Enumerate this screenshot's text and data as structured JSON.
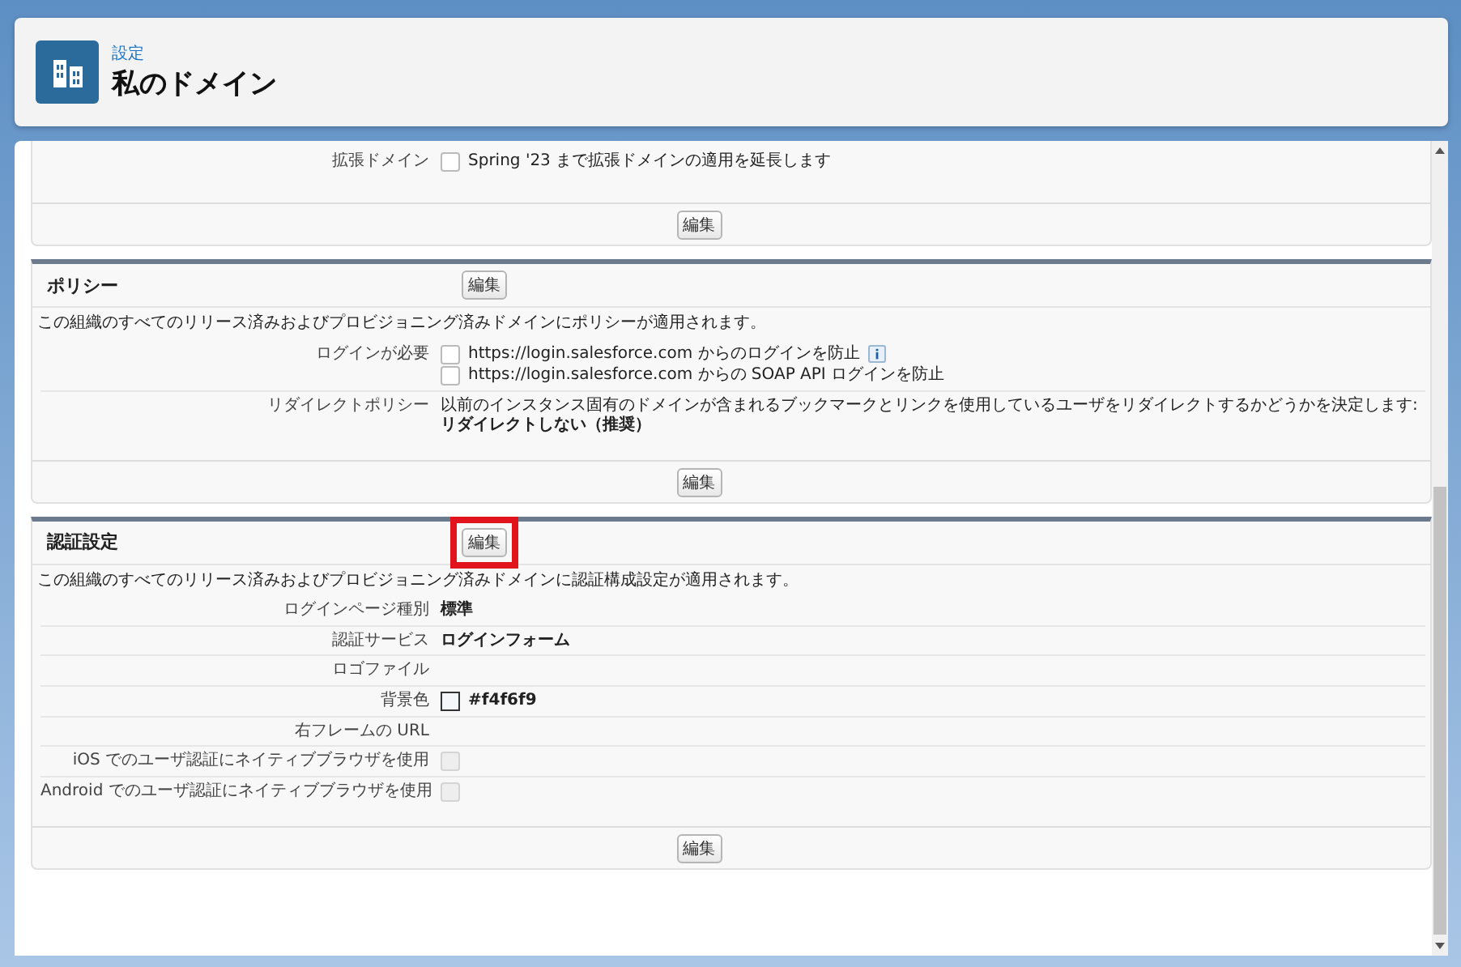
{
  "header": {
    "breadcrumb": "設定",
    "title": "私のドメイン"
  },
  "sections": [
    {
      "rows": [
        {
          "label": "拡張ドメイン",
          "kind": "checkboxes",
          "options": [
            {
              "text": "Spring '23 まで拡張ドメインの適用を延長します",
              "checked": false,
              "disabled": false,
              "info": false
            }
          ]
        }
      ],
      "footer_button": {
        "label": "編集"
      }
    },
    {
      "title": "ポリシー",
      "header_button": {
        "label": "編集"
      },
      "description": "この組織のすべてのリリース済みおよびプロビジョニング済みドメインにポリシーが適用されます。",
      "rows": [
        {
          "label": "ログインが必要",
          "kind": "checkboxes",
          "options": [
            {
              "text": "https://login.salesforce.com からのログインを防止",
              "checked": false,
              "disabled": false,
              "info": true
            },
            {
              "text": "https://login.salesforce.com からの SOAP API ログインを防止",
              "checked": false,
              "disabled": false,
              "info": false
            }
          ]
        },
        {
          "label": "リダイレクトポリシー",
          "kind": "text",
          "lines": [
            {
              "text": "以前のインスタンス固有のドメインが含まれるブックマークとリンクを使用しているユーザをリダイレクトするかどうかを決定します:",
              "bold": false
            },
            {
              "text": "リダイレクトしない（推奨）",
              "bold": true
            }
          ]
        }
      ],
      "footer_button": {
        "label": "編集"
      }
    },
    {
      "title": "認証設定",
      "header_button": {
        "label": "編集",
        "highlighted": true
      },
      "description": "この組織のすべてのリリース済みおよびプロビジョニング済みドメインに認証構成設定が適用されます。",
      "rows": [
        {
          "label": "ログインページ種別",
          "kind": "text",
          "lines": [
            {
              "text": "標準",
              "bold": true
            }
          ]
        },
        {
          "label": "認証サービス",
          "kind": "text",
          "lines": [
            {
              "text": "ログインフォーム",
              "bold": true
            }
          ]
        },
        {
          "label": "ロゴファイル",
          "kind": "text",
          "lines": []
        },
        {
          "label": "背景色",
          "kind": "color",
          "color": "#f4f6f9",
          "value": "#f4f6f9"
        },
        {
          "label": "右フレームの URL",
          "kind": "text",
          "lines": []
        },
        {
          "label": "iOS でのユーザ認証にネイティブブラウザを使用",
          "kind": "checkboxes",
          "options": [
            {
              "checked": false,
              "disabled": true,
              "info": false
            }
          ]
        },
        {
          "label": "Android でのユーザ認証にネイティブブラウザを使用",
          "kind": "checkboxes",
          "options": [
            {
              "checked": false,
              "disabled": true,
              "info": false
            }
          ]
        }
      ],
      "footer_button": {
        "label": "編集"
      }
    }
  ]
}
